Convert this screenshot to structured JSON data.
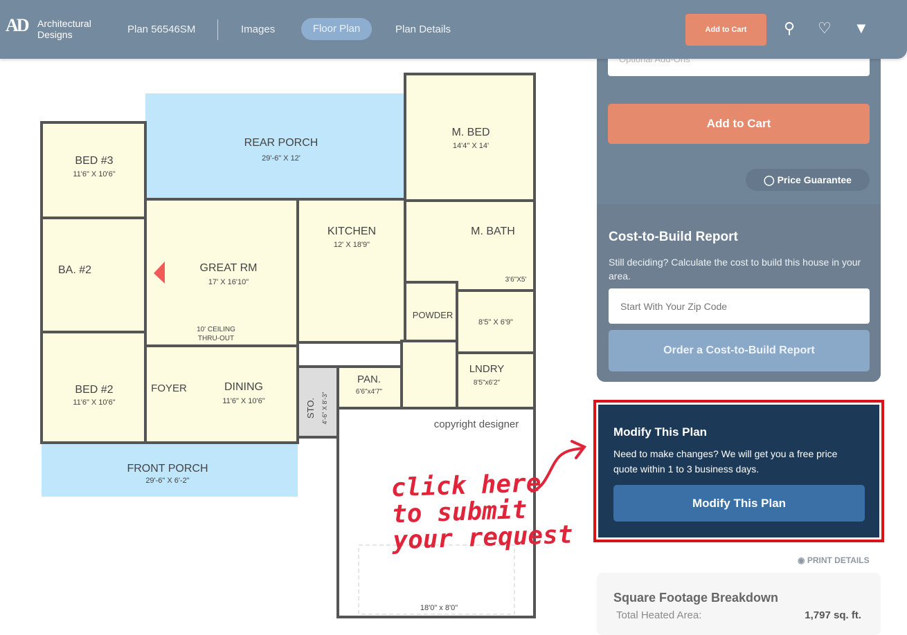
{
  "header": {
    "logo_line1": "Architectural",
    "logo_line2": "Designs",
    "logo_mark": "AD",
    "plan_number": "Plan 56546SM",
    "nav": [
      "Images",
      "Floor Plan",
      "Plan Details"
    ],
    "active_nav": "Floor Plan",
    "add_to_cart": "Add to Cart",
    "icons": [
      "user-icon",
      "heart-icon",
      "cart-icon"
    ]
  },
  "purchase": {
    "dropdown_value": "Optional Add-Ons",
    "add_to_cart": "Add to Cart",
    "price_guarantee": "Price Guarantee"
  },
  "cost_to_build": {
    "title": "Cost-to-Build Report",
    "description": "Still deciding? Calculate the cost to build this house in your area.",
    "zip_placeholder": "Start With Your Zip Code",
    "order_button": "Order a Cost-to-Build Report"
  },
  "modify": {
    "title": "Modify This Plan",
    "description": "Need to make changes? We will get you a free price quote within 1 to 3 business days.",
    "button": "Modify This Plan"
  },
  "annotation": {
    "line1": "click here",
    "line2": "to submit",
    "line3": "your request",
    "color": "#e0243a"
  },
  "print_details": "PRINT DETAILS",
  "sqft": {
    "title": "Square Footage Breakdown",
    "label": "Total Heated Area:",
    "value": "1,797 sq. ft."
  },
  "floor_plan": {
    "copyright": "copyright designer",
    "ceiling_note1": "10' CEILING",
    "ceiling_note2": "THRU-OUT",
    "rooms": [
      {
        "name": "REAR PORCH",
        "dims": "29'-6\" X 12'"
      },
      {
        "name": "M. BED",
        "dims": "14'4\" X 14'"
      },
      {
        "name": "BED #3",
        "dims": "11'6\" X 10'6\""
      },
      {
        "name": "BA. #2",
        "dims": ""
      },
      {
        "name": "GREAT RM",
        "dims": "17' X 16'10\""
      },
      {
        "name": "KITCHEN",
        "dims": "12' X 18'9\""
      },
      {
        "name": "M. BATH",
        "dims": ""
      },
      {
        "name": "POWDER",
        "dims": ""
      },
      {
        "name": "BED #2",
        "dims": "11'6\" X 10'6\""
      },
      {
        "name": "FOYER",
        "dims": ""
      },
      {
        "name": "DINING",
        "dims": "11'6\" X 10'6\""
      },
      {
        "name": "PAN.",
        "dims": "6'6\"x4'7\""
      },
      {
        "name": "LNDRY",
        "dims": "8'5\"x6'2\""
      },
      {
        "name": "FRONT PORCH",
        "dims": "29'-6\" X 6'-2\""
      },
      {
        "name": "STO.",
        "dims": "4'-6\" X 8'-3\""
      },
      {
        "name": "",
        "dims": "8'5\" X 6'9\""
      },
      {
        "name": "",
        "dims": "3'6\"X5'"
      },
      {
        "name": "",
        "dims": "18'0\" x 8'0\""
      }
    ]
  }
}
